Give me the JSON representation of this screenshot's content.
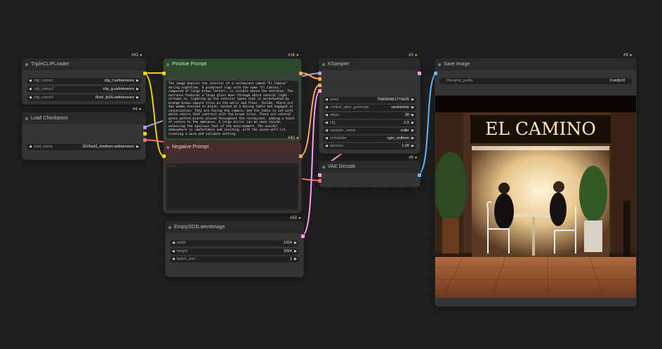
{
  "nodes": {
    "triple_clip": {
      "title": "TripleCLIPLoader",
      "id": "#43",
      "widgets": [
        {
          "name": "clip_name1",
          "value": "clip_l.safetensors"
        },
        {
          "name": "clip_name2",
          "value": "clip_g.safetensors"
        },
        {
          "name": "clip_name3",
          "value": "t5xxl_fp16.safetensors"
        }
      ]
    },
    "load_checkpoint": {
      "title": "Load Checkpoint",
      "id": "#4",
      "widgets": [
        {
          "name": "ckpt_name",
          "value": "SD3\\sd3_medium.safetensors"
        }
      ]
    },
    "positive_prompt": {
      "title": "Positive Prompt",
      "id": "#16",
      "text": "The image depicts the interior of a restaurant named \"El Camino\" during nighttime. A prominent sign with the name \"El Camino,\" composed of large brown letters, is visible above the entrance. The entrance features a large glass door through which natural light streams in, lighting up the interior space that is accentuated by orange-brown square tiles on the walls and floor. Inside, there are two women dressed in black, seated at a dining table and engaged in conversation. They are facing the camera, and the table is set with white chairs that contrast with the brown tiles. There are several green potted plants placed throughout the restaurant, adding a touch of nature to the ambiance. A large mirror can be seen inside, enhancing the spacious feel of the environment. The overall atmosphere is comfortable and inviting, with the space well-lit, creating a warm and sociable setting."
    },
    "negative_prompt": {
      "title": "Negative Prompt",
      "id": "#40",
      "placeholder": "text"
    },
    "empty_latent": {
      "title": "EmptySD3LatentImage",
      "id": "#53",
      "widgets": [
        {
          "name": "width",
          "value": "1024"
        },
        {
          "name": "height",
          "value": "1024"
        },
        {
          "name": "batch_size",
          "value": "1"
        }
      ]
    },
    "ksampler": {
      "title": "KSampler",
      "id": "#3",
      "widgets": [
        {
          "name": "seed",
          "value": "758060961779625"
        },
        {
          "name": "control_after_generate",
          "value": "randomize"
        },
        {
          "name": "steps",
          "value": "30"
        },
        {
          "name": "cfg",
          "value": "5.5"
        },
        {
          "name": "sampler_name",
          "value": "euler"
        },
        {
          "name": "scheduler",
          "value": "sgm_uniform"
        },
        {
          "name": "denoise",
          "value": "1.00"
        }
      ]
    },
    "vae_decode": {
      "title": "VAE Decode",
      "id": "#8"
    },
    "save_image": {
      "title": "Save Image",
      "id": "#9",
      "widgets": [
        {
          "name": "filename_prefix",
          "value": "ComfyUI"
        }
      ],
      "preview_sign": "EL CAMINO"
    }
  },
  "colors": {
    "clip_wire": "#f5d300",
    "model_wire": "#b39ddb",
    "conditioning_wire": "#ffa94d",
    "latent_wire": "#ff9cf9",
    "vae_wire": "#ff6e6e",
    "image_wire": "#64b5f6",
    "lock": "#e6c200"
  }
}
